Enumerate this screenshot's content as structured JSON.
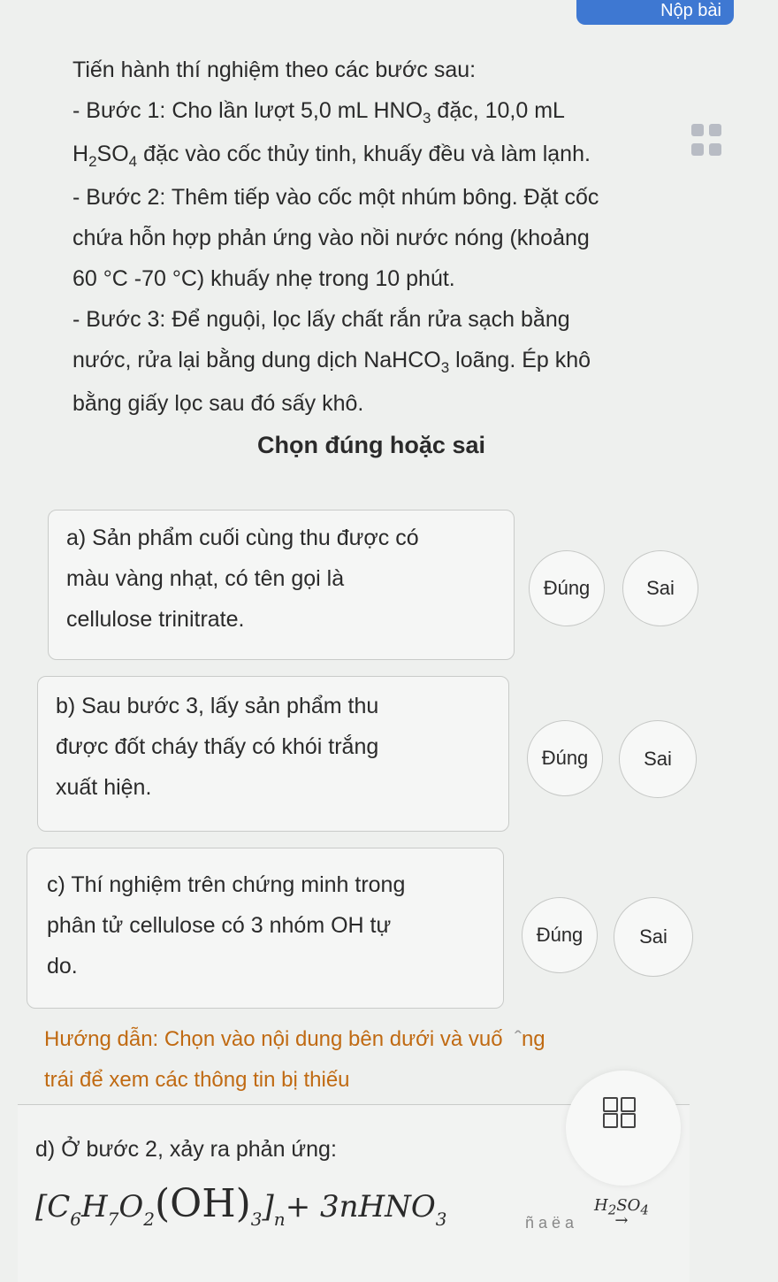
{
  "top_button": {
    "label": "Nộp bài"
  },
  "intro": {
    "line0": "Tiến hành thí nghiệm theo các bước sau:",
    "step1_a": "- Bước 1: Cho lần lượt 5,0 mL HNO",
    "step1_sub": "3",
    "step1_b": " đặc, 10,0 mL",
    "step1_c": "H",
    "step1_c_sub1": "2",
    "step1_d": "SO",
    "step1_d_sub": "4",
    "step1_e": " đặc vào cốc thủy tinh, khuấy đều và làm lạnh.",
    "step2_a": "- Bước 2: Thêm tiếp vào cốc một nhúm bông. Đặt cốc",
    "step2_b": "chứa hỗn hợp phản ứng vào nồi nước nóng (khoảng",
    "step2_c": "60 °C -70 °C) khuấy nhẹ trong 10 phút.",
    "step3_a": "- Bước 3: Để nguội, lọc lấy chất rắn rửa sạch bằng",
    "step3_b": "nước, rửa lại bằng dung dịch NaHCO",
    "step3_b_sub": "3",
    "step3_c": " loãng. Ép khô",
    "step3_d": "bằng giấy lọc sau đó sấy khô."
  },
  "heading": "Chọn đúng hoặc sai",
  "statements": [
    {
      "line1": "a) Sản phẩm cuối cùng thu được có",
      "line2": "màu vàng nhạt, có tên gọi là",
      "line3": "cellulose trinitrate.",
      "true_label": "Đúng",
      "false_label": "Sai"
    },
    {
      "line1": "b) Sau bước 3, lấy sản phẩm thu",
      "line2": "được đốt cháy thấy có khói trắng",
      "line3": "xuất hiện.",
      "true_label": "Đúng",
      "false_label": "Sai"
    },
    {
      "line1": "c) Thí nghiệm trên chứng minh trong",
      "line2": "phân tử cellulose có 3 nhóm OH tự",
      "line3": "do.",
      "true_label": "Đúng",
      "false_label": "Sai"
    }
  ],
  "guide": {
    "line1": "Hướng dẫn: Chọn vào nội dung bên dưới và vuố",
    "line1_end": "ng",
    "line2": "trái để xem các thông tin bị thiếu"
  },
  "statement_d": {
    "text": "d) Ở bước 2, xảy ra phản ứng:"
  },
  "formula": {
    "open": "[C",
    "s6": "6",
    "h": "H",
    "s7": "7",
    "o": "O",
    "s2": "2",
    "oh": "(OH)",
    "s3": "3",
    "close": "]",
    "n": "n",
    "plus": "+ 3nHNO",
    "s3b": "3",
    "arrow_top": "H",
    "arrow_s2": "2",
    "arrow_so": "SO",
    "arrow_s4": "4",
    "arrow": "→",
    "faint": "ñ a ë a"
  }
}
